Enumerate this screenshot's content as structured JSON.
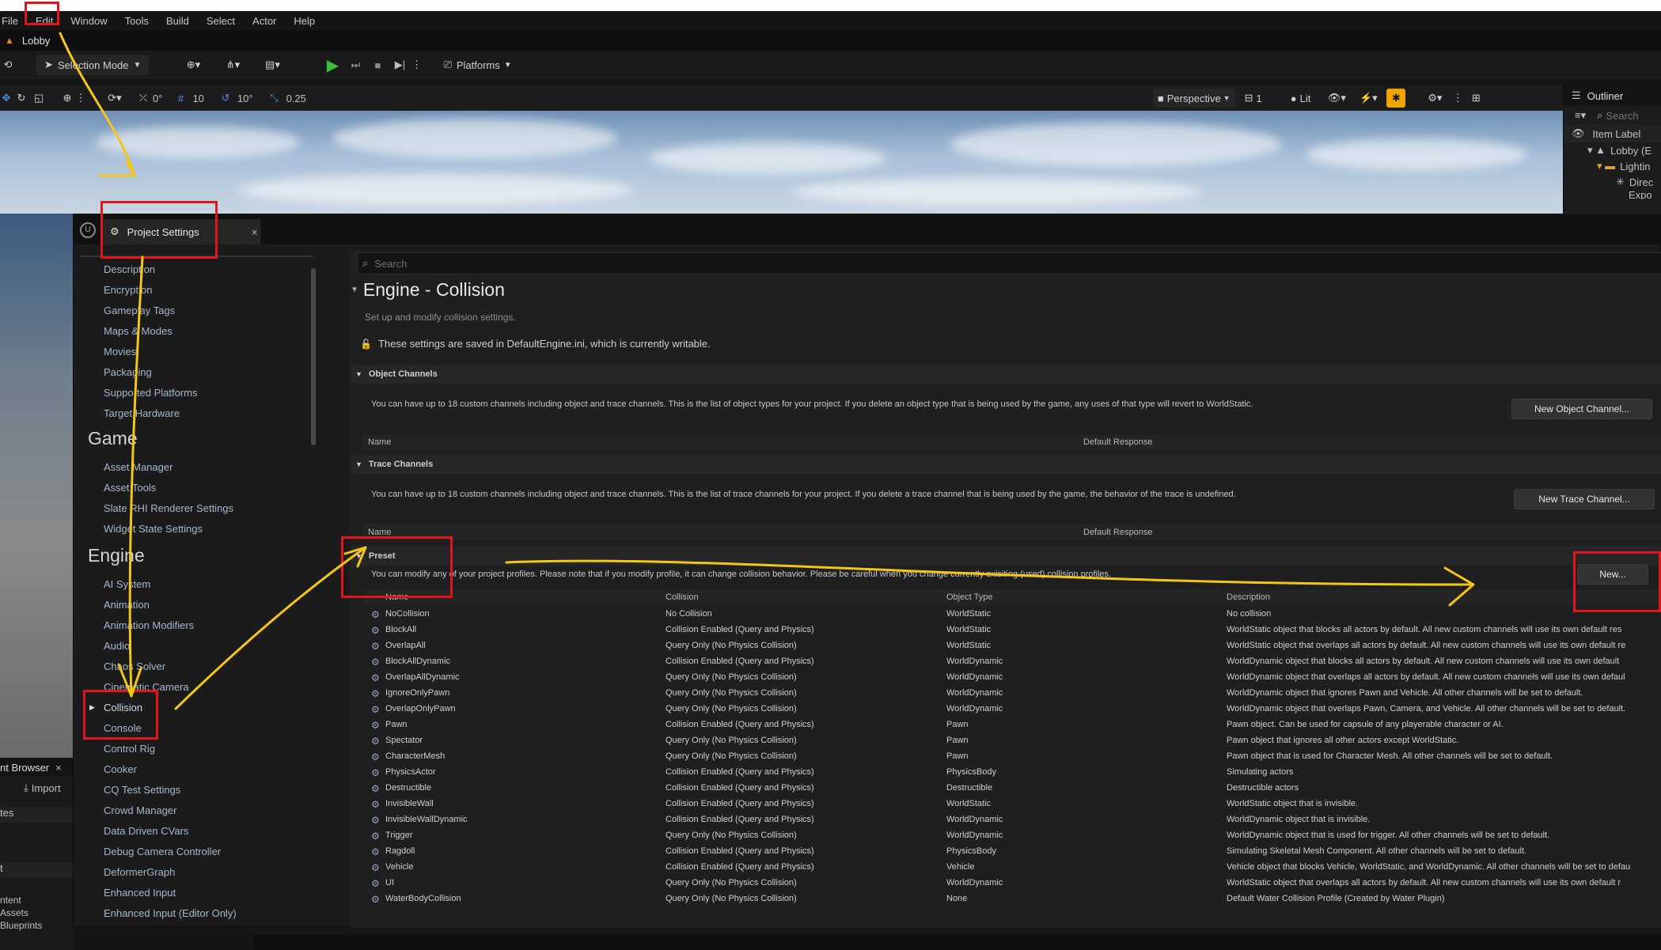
{
  "menu": [
    "File",
    "Edit",
    "Window",
    "Tools",
    "Build",
    "Select",
    "Actor",
    "Help"
  ],
  "level_tab": "Lobby",
  "toolbar": {
    "selection_mode": "Selection Mode",
    "platforms": "Platforms"
  },
  "viewport_toolbar": {
    "rotate_snap": "0°",
    "grid": "10",
    "angle": "10°",
    "scale": "0.25",
    "perspective": "Perspective",
    "lit": "Lit",
    "camera_speed": "1"
  },
  "outliner": {
    "title": "Outliner",
    "search": "Search",
    "col": "Item Label",
    "items": [
      "Lobby (E",
      "Lightin",
      "Direc",
      "Expo"
    ]
  },
  "content_browser": {
    "tab": "nt Browser",
    "import": "Import",
    "labels": [
      "tes",
      "t",
      "ntent",
      "Assets",
      "Blueprints"
    ]
  },
  "project_settings": {
    "title": "Project Settings",
    "nav_project": [
      "Description",
      "Encryption",
      "Gameplay Tags",
      "Maps & Modes",
      "Movies",
      "Packaging",
      "Supported Platforms",
      "Target Hardware"
    ],
    "nav_game_header": "Game",
    "nav_game": [
      "Asset Manager",
      "Asset Tools",
      "Slate RHI Renderer Settings",
      "Widget State Settings"
    ],
    "nav_engine_header": "Engine",
    "nav_engine": [
      "AI System",
      "Animation",
      "Animation Modifiers",
      "Audio",
      "Chaos Solver",
      "Cinematic Camera",
      "Collision",
      "Console",
      "Control Rig",
      "Cooker",
      "CQ Test Settings",
      "Crowd Manager",
      "Data Driven CVars",
      "Debug Camera Controller",
      "DeformerGraph",
      "Enhanced Input",
      "Enhanced Input (Editor Only)"
    ],
    "search_placeholder": "Search",
    "section_title": "Engine - Collision",
    "section_subtitle": "Set up and modify collision settings.",
    "saved_notice": "These settings are saved in DefaultEngine.ini, which is currently writable.",
    "object_channels": {
      "header": "Object Channels",
      "desc": "You can have up to 18 custom channels including object and trace channels. This is the list of object types for your project. If you delete an object type that is being used by the game, any uses of that type will revert to WorldStatic.",
      "button": "New Object Channel...",
      "col_name": "Name",
      "col_default": "Default Response"
    },
    "trace_channels": {
      "header": "Trace Channels",
      "desc": "You can have up to 18 custom channels including object and trace channels. This is the list of trace channels for your project. If you delete a trace channel that is being used by the game, the behavior of the trace is undefined.",
      "button": "New Trace Channel...",
      "col_name": "Name",
      "col_default": "Default Response"
    },
    "preset": {
      "header": "Preset",
      "desc": "You can modify any of your project profiles. Please note that if you modify profile, it can change collision behavior. Please be careful when you change currently exisiting (used) collision profiles.",
      "button": "New...",
      "columns": [
        "Name",
        "Collision",
        "Object Type",
        "Description"
      ],
      "rows": [
        [
          "NoCollision",
          "No Collision",
          "WorldStatic",
          "No collision"
        ],
        [
          "BlockAll",
          "Collision Enabled (Query and Physics)",
          "WorldStatic",
          "WorldStatic object that blocks all actors by default. All new custom channels will use its own default res"
        ],
        [
          "OverlapAll",
          "Query Only (No Physics Collision)",
          "WorldStatic",
          "WorldStatic object that overlaps all actors by default. All new custom channels will use its own default re"
        ],
        [
          "BlockAllDynamic",
          "Collision Enabled (Query and Physics)",
          "WorldDynamic",
          "WorldDynamic object that blocks all actors by default. All new custom channels will use its own default"
        ],
        [
          "OverlapAllDynamic",
          "Query Only (No Physics Collision)",
          "WorldDynamic",
          "WorldDynamic object that overlaps all actors by default. All new custom channels will use its own defaul"
        ],
        [
          "IgnoreOnlyPawn",
          "Query Only (No Physics Collision)",
          "WorldDynamic",
          "WorldDynamic object that ignores Pawn and Vehicle. All other channels will be set to default."
        ],
        [
          "OverlapOnlyPawn",
          "Query Only (No Physics Collision)",
          "WorldDynamic",
          "WorldDynamic object that overlaps Pawn, Camera, and Vehicle. All other channels will be set to default."
        ],
        [
          "Pawn",
          "Collision Enabled (Query and Physics)",
          "Pawn",
          "Pawn object. Can be used for capsule of any playerable character or AI."
        ],
        [
          "Spectator",
          "Query Only (No Physics Collision)",
          "Pawn",
          "Pawn object that ignores all other actors except WorldStatic."
        ],
        [
          "CharacterMesh",
          "Query Only (No Physics Collision)",
          "Pawn",
          "Pawn object that is used for Character Mesh. All other channels will be set to default."
        ],
        [
          "PhysicsActor",
          "Collision Enabled (Query and Physics)",
          "PhysicsBody",
          "Simulating actors"
        ],
        [
          "Destructible",
          "Collision Enabled (Query and Physics)",
          "Destructible",
          "Destructible actors"
        ],
        [
          "InvisibleWall",
          "Collision Enabled (Query and Physics)",
          "WorldStatic",
          "WorldStatic object that is invisible."
        ],
        [
          "InvisibleWallDynamic",
          "Collision Enabled (Query and Physics)",
          "WorldDynamic",
          "WorldDynamic object that is invisible."
        ],
        [
          "Trigger",
          "Query Only (No Physics Collision)",
          "WorldDynamic",
          "WorldDynamic object that is used for trigger. All other channels will be set to default."
        ],
        [
          "Ragdoll",
          "Collision Enabled (Query and Physics)",
          "PhysicsBody",
          "Simulating Skeletal Mesh Component. All other channels will be set to default."
        ],
        [
          "Vehicle",
          "Collision Enabled (Query and Physics)",
          "Vehicle",
          "Vehicle object that blocks Vehicle, WorldStatic, and WorldDynamic. All other channels will be set to defau"
        ],
        [
          "UI",
          "Query Only (No Physics Collision)",
          "WorldDynamic",
          "WorldStatic object that overlaps all actors by default. All new custom channels will use its own default r"
        ],
        [
          "WaterBodyCollision",
          "Query Only (No Physics Collision)",
          "None",
          "Default Water Collision Profile (Created by Water Plugin)"
        ]
      ]
    }
  },
  "colors": {
    "annotation_red": "#e0161f",
    "annotation_yellow": "#f5c518",
    "play_green": "#3fbf3f",
    "link_blue": "#a6b7cc"
  }
}
